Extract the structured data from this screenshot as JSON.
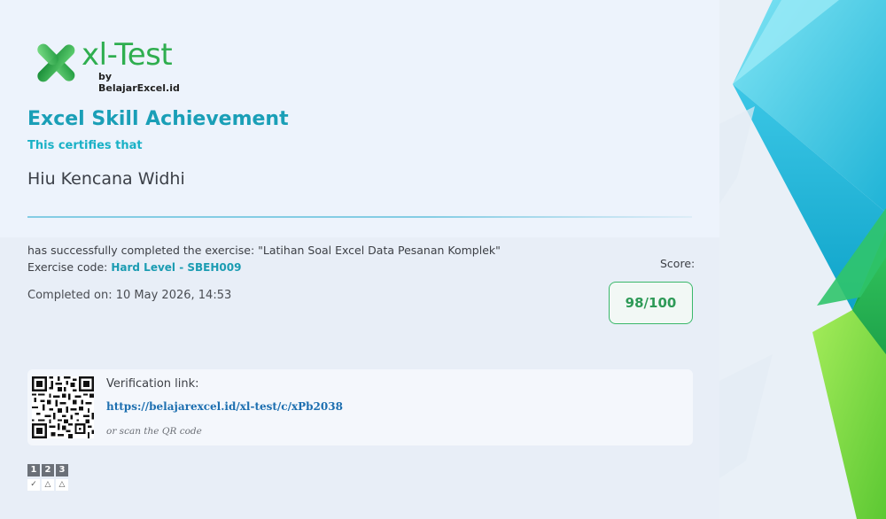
{
  "logo": {
    "name": "xl-Test",
    "byline": "by BelajarExcel.id"
  },
  "certificate": {
    "title": "Excel Skill Achievement",
    "certifies": "This certifies that",
    "recipient": "Hiu Kencana Widhi",
    "completed_text": "has successfully completed the exercise: \"Latihan Soal Excel Data Pesanan Komplek\"",
    "exercise_code_label": "Exercise code:",
    "exercise_code": "Hard Level - SBEH009",
    "completed_on": "Completed on: 10 May 2026, 14:53"
  },
  "score": {
    "label": "Score:",
    "value": "98/100"
  },
  "verification": {
    "label": "Verification link:",
    "link": "https://belajarexcel.id/xl-test/c/xPb2038",
    "hint": "or scan the QR code"
  },
  "steps": {
    "numbers": [
      "1",
      "2",
      "3"
    ],
    "marks": [
      "✓",
      "△",
      "△"
    ]
  },
  "colors": {
    "accent": "#1a9fb7",
    "brand_green": "#2fae4f",
    "score_green": "#2e9a57",
    "link": "#1d6fb0"
  }
}
